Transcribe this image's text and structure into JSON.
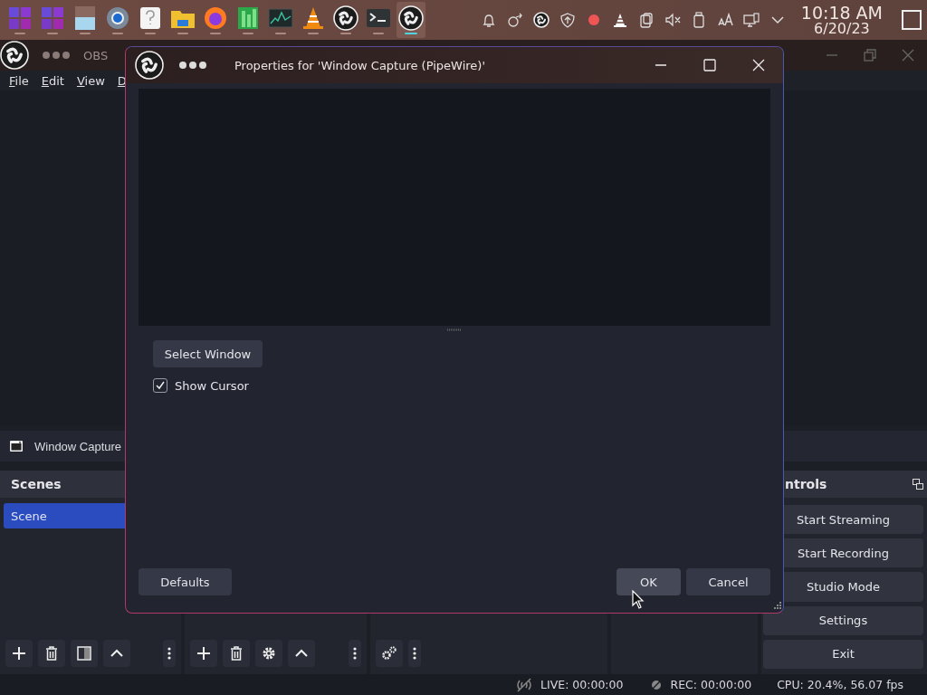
{
  "taskbar": {
    "apps": [
      {
        "selected": false
      },
      {
        "selected": false
      },
      {
        "selected": false
      },
      {
        "selected": false
      },
      {
        "selected": false
      },
      {
        "selected": false
      },
      {
        "selected": false
      },
      {
        "selected": false
      },
      {
        "selected": false
      },
      {
        "selected": false
      },
      {
        "selected": false
      },
      {
        "selected": false
      },
      {
        "selected": true
      }
    ],
    "clock": {
      "time": "10:18 AM",
      "date": "6/20/23"
    }
  },
  "main_window": {
    "title": "OBS",
    "menu": [
      "File",
      "Edit",
      "View",
      "D"
    ],
    "source_toolbar": {
      "source": "Window Capture"
    },
    "scenes": {
      "title": "Scenes",
      "items": [
        {
          "label": "Scene",
          "selected": true
        }
      ]
    },
    "controls": {
      "title": "ntrols",
      "buttons": [
        "Start Streaming",
        "Start Recording",
        "Studio Mode",
        "Settings",
        "Exit"
      ]
    },
    "status_bar": {
      "live": "LIVE: 00:00:00",
      "rec": "REC: 00:00:00",
      "cpu": "CPU: 20.4%, 56.07 fps"
    }
  },
  "dialog": {
    "title": "Properties for 'Window Capture (PipeWire)'",
    "select_button": "Select Window",
    "show_cursor": {
      "label": "Show Cursor",
      "checked": true
    },
    "buttons": {
      "defaults": "Defaults",
      "ok": "OK",
      "cancel": "Cancel"
    }
  }
}
